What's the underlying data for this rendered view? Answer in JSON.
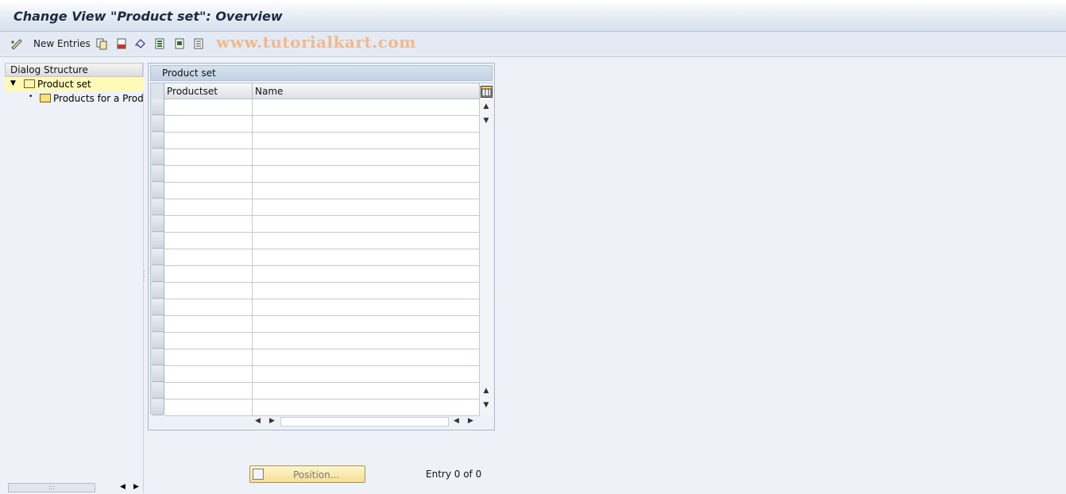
{
  "window": {
    "title": "Change View \"Product set\": Overview"
  },
  "toolbar": {
    "new_entries_label": "New Entries",
    "watermark": "www.tutorialkart.com",
    "icons": [
      "edit-toggle-icon",
      "copy-icon",
      "delete-icon",
      "undo-icon",
      "select-all-icon",
      "select-block-icon",
      "deselect-all-icon"
    ]
  },
  "dialog_structure": {
    "header": "Dialog Structure",
    "items": [
      {
        "label": "Product set",
        "selected": true,
        "expanded": true
      },
      {
        "label": "Products for a Product set",
        "selected": false
      }
    ]
  },
  "table": {
    "title": "Product set",
    "columns": [
      "Productset",
      "Name"
    ],
    "rows": []
  },
  "footer": {
    "position_button": "Position...",
    "entry_text": "Entry 0 of 0"
  },
  "colors": {
    "accent_yellow": "#fff9b8",
    "title_text": "#1a2b44"
  }
}
